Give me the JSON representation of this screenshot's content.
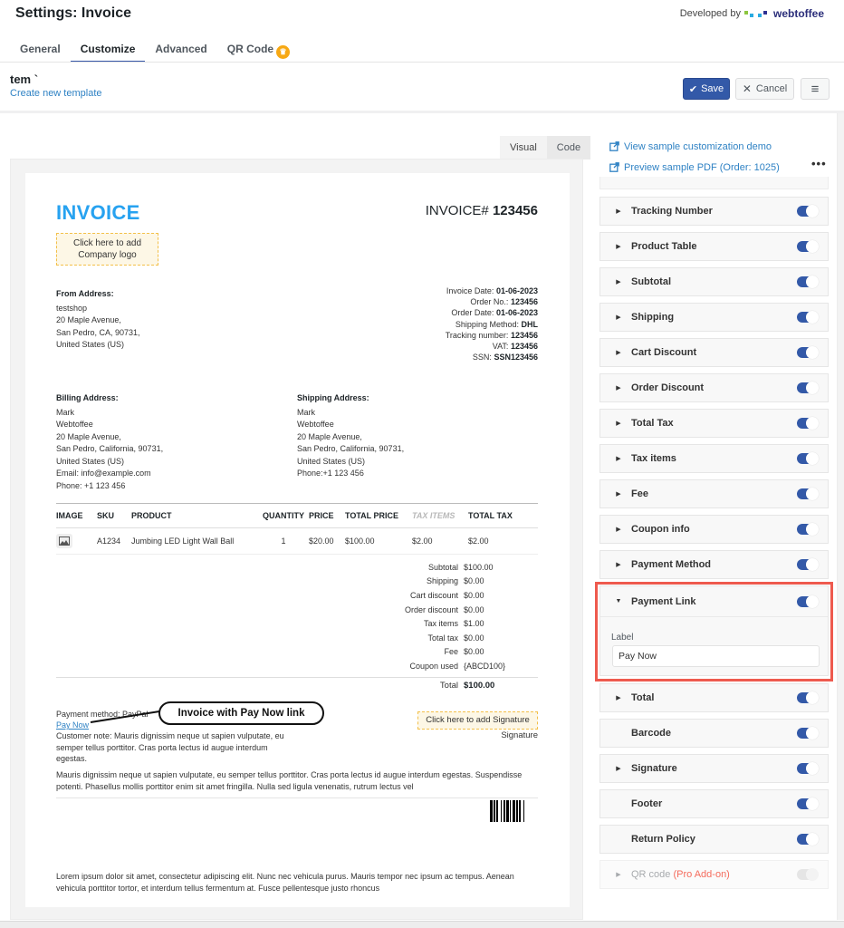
{
  "header": {
    "title": "Settings: Invoice",
    "developed_by": "Developed by",
    "brand": "webtoffee",
    "brand_colors": [
      "#8cc63f",
      "#29abe2",
      "#2e3192"
    ]
  },
  "tabs": [
    {
      "label": "General",
      "active": false
    },
    {
      "label": "Customize",
      "active": true
    },
    {
      "label": "Advanced",
      "active": false
    },
    {
      "label": "QR Code",
      "active": false,
      "badge": "crown-icon"
    }
  ],
  "template": {
    "name": "tem `",
    "create_link": "Create new template"
  },
  "toolbar": {
    "save_label": "Save",
    "cancel_label": "Cancel",
    "accent": "#3359a8"
  },
  "view_tabs": [
    {
      "label": "Visual",
      "active": true
    },
    {
      "label": "Code",
      "active": false
    }
  ],
  "invoice": {
    "title": "INVOICE",
    "number_prefix": "INVOICE#",
    "number": "123456",
    "logo_placeholder": "Click here to add Company logo",
    "from": {
      "heading": "From Address:",
      "lines": [
        "testshop",
        "20 Maple Avenue,",
        "San Pedro, CA, 90731,",
        "United States (US)"
      ]
    },
    "meta": [
      {
        "label": "Invoice Date:",
        "value": "01-06-2023"
      },
      {
        "label": "Order No.:",
        "value": "123456"
      },
      {
        "label": "Order Date:",
        "value": "01-06-2023"
      },
      {
        "label": "Shipping Method:",
        "value": "DHL"
      },
      {
        "label": "Tracking number:",
        "value": "123456"
      },
      {
        "label": "VAT:",
        "value": "123456"
      },
      {
        "label": "SSN:",
        "value": "SSN123456"
      }
    ],
    "billing": {
      "heading": "Billing Address:",
      "lines": [
        "Mark",
        "Webtoffee",
        "20 Maple Avenue,",
        "San Pedro, California, 90731,",
        "United States (US)",
        "Email: info@example.com",
        "Phone: +1 123 456"
      ]
    },
    "shipping": {
      "heading": "Shipping Address:",
      "lines": [
        "Mark",
        "Webtoffee",
        "20 Maple Avenue,",
        "San Pedro, California, 90731,",
        "United States (US)",
        "Phone:+1 123 456"
      ]
    },
    "table": {
      "headers": [
        "IMAGE",
        "SKU",
        "PRODUCT",
        "QUANTITY",
        "PRICE",
        "TOTAL PRICE",
        "TAX ITEMS",
        "TOTAL TAX"
      ],
      "rows": [
        {
          "sku": "A1234",
          "product": "Jumbing LED Light Wall Ball",
          "quantity": "1",
          "price": "$20.00",
          "total_price": "$100.00",
          "tax_items": "$2.00",
          "total_tax": "$2.00"
        }
      ]
    },
    "totals": [
      {
        "label": "Subtotal",
        "value": "$100.00"
      },
      {
        "label": "Shipping",
        "value": "$0.00"
      },
      {
        "label": "Cart discount",
        "value": "$0.00"
      },
      {
        "label": "Order discount",
        "value": "$0.00"
      },
      {
        "label": "Tax items",
        "value": "$1.00"
      },
      {
        "label": "Total tax",
        "value": "$0.00"
      },
      {
        "label": "Fee",
        "value": "$0.00"
      },
      {
        "label": "Coupon used",
        "value": "{ABCD100}"
      }
    ],
    "grand_total": {
      "label": "Total",
      "value": "$100.00"
    },
    "payment_method": "Payment method: PayPal",
    "pay_now": "Pay Now",
    "customer_note": "Customer note: Mauris dignissim neque ut sapien vulputate, eu semper tellus porttitor. Cras porta lectus id augue interdum egestas.",
    "callout": "Invoice with Pay Now link",
    "signature_placeholder": "Click here to add Signature",
    "signature_label": "Signature",
    "return_policy": "Mauris dignissim neque ut sapien vulputate, eu semper tellus porttitor. Cras porta lectus id augue interdum egestas. Suspendisse potenti. Phasellus mollis porttitor enim sit amet fringilla. Nulla sed ligula venenatis, rutrum lectus vel",
    "footer": "Lorem ipsum dolor sit amet, consectetur adipiscing elit. Nunc nec vehicula purus. Mauris tempor nec ipsum ac tempus. Aenean vehicula porttitor tortor, et interdum tellus fermentum at. Fusce pellentesque justo rhoncus"
  },
  "sidebar": {
    "links": [
      {
        "label": "View sample customization demo",
        "icon": "external-link-icon"
      },
      {
        "label": "Preview sample PDF (Order: 1025)",
        "icon": "external-link-icon"
      }
    ],
    "more": "•••",
    "sections": [
      {
        "title": "Tracking Number",
        "expandable": true,
        "enabled": true
      },
      {
        "title": "Product Table",
        "expandable": true,
        "enabled": true
      },
      {
        "title": "Subtotal",
        "expandable": true,
        "enabled": true
      },
      {
        "title": "Shipping",
        "expandable": true,
        "enabled": true
      },
      {
        "title": "Cart Discount",
        "expandable": true,
        "enabled": true
      },
      {
        "title": "Order Discount",
        "expandable": true,
        "enabled": true
      },
      {
        "title": "Total Tax",
        "expandable": true,
        "enabled": true
      },
      {
        "title": "Tax items",
        "expandable": true,
        "enabled": true
      },
      {
        "title": "Fee",
        "expandable": true,
        "enabled": true
      },
      {
        "title": "Coupon info",
        "expandable": true,
        "enabled": true
      },
      {
        "title": "Payment Method",
        "expandable": true,
        "enabled": true
      }
    ],
    "payment_link": {
      "title": "Payment Link",
      "enabled": true,
      "expanded": true,
      "field_label": "Label",
      "field_value": "Pay Now",
      "highlight_color": "#ee5a4e"
    },
    "sections_after": [
      {
        "title": "Total",
        "expandable": true,
        "enabled": true
      },
      {
        "title": "Barcode",
        "expandable": false,
        "enabled": true
      },
      {
        "title": "Signature",
        "expandable": true,
        "enabled": true
      },
      {
        "title": "Footer",
        "expandable": false,
        "enabled": true
      },
      {
        "title": "Return Policy",
        "expandable": false,
        "enabled": true
      }
    ],
    "qr": {
      "title": "QR code",
      "pro": "(Pro Add-on)",
      "enabled": false,
      "disabled": true
    }
  }
}
